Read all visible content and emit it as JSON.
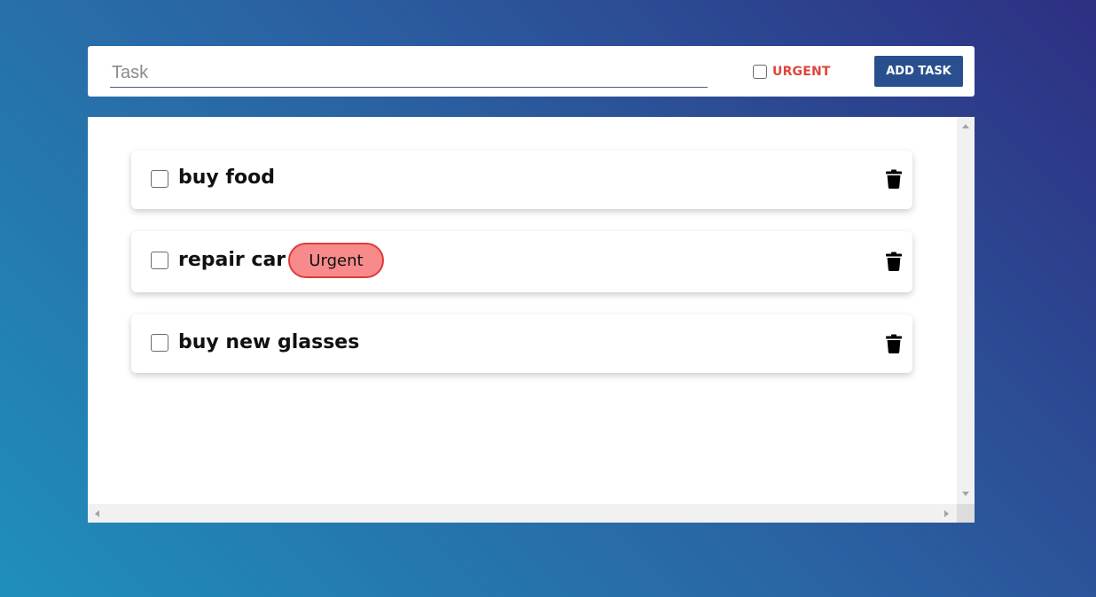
{
  "form": {
    "task_placeholder": "Task",
    "task_value": "",
    "urgent_label": "URGENT",
    "urgent_checked": false,
    "add_button_label": "ADD TASK"
  },
  "tasks": [
    {
      "text": "buy food",
      "checked": false,
      "urgent": false,
      "icon": "trash-icon"
    },
    {
      "text": "repair car",
      "checked": false,
      "urgent": true,
      "badge_label": "Urgent",
      "icon": "trash-icon"
    },
    {
      "text": "buy new glasses",
      "checked": false,
      "urgent": false,
      "icon": "trash-icon"
    }
  ],
  "colors": {
    "accent_button": "#2a4f8f",
    "urgent_text": "#e0453a",
    "urgent_badge_fill": "#f78b8b",
    "urgent_badge_border": "#e03a3a",
    "background_gradient": [
      "#1f8fbb",
      "#2a63a3",
      "#2e2f82"
    ]
  }
}
